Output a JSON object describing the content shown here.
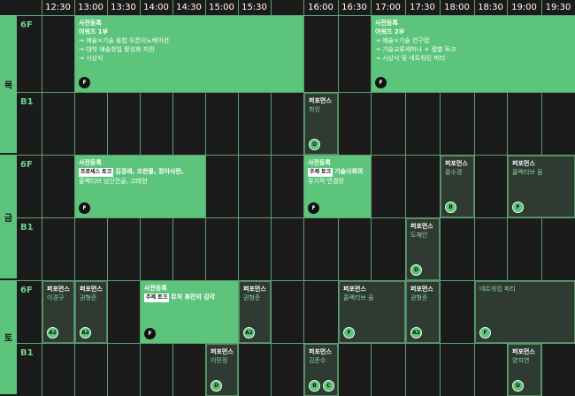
{
  "times": [
    "12:30",
    "13:00",
    "13:30",
    "14:00",
    "14:30",
    "15:00",
    "15:30",
    "",
    "16:00",
    "16:30",
    "17:00",
    "17:30",
    "18:00",
    "18:30",
    "19:00",
    "19:30"
  ],
  "days": [
    {
      "label": "목",
      "floors": [
        "6F",
        "B1"
      ]
    },
    {
      "label": "금",
      "floors": [
        "6F",
        "B1"
      ]
    },
    {
      "label": "토",
      "floors": [
        "6F",
        "B1"
      ]
    }
  ],
  "events": [
    {
      "row": 0,
      "s": 1,
      "e": 8,
      "kind": "green",
      "type": "사전등록",
      "title": "어워즈 1부",
      "lines": [
        "→ 예술×기술 융합 오픈이노베이션",
        "→ 대학 예술창업 활성화 지원",
        "→ 시상식"
      ],
      "badges": [
        "F"
      ]
    },
    {
      "row": 0,
      "s": 10,
      "e": 16,
      "kind": "green",
      "type": "사전등록",
      "title": "어워즈 2부",
      "lines": [
        "→ 예술×기술 연구랩",
        "→ 기술교류세미나 + 랩별 토크",
        "→ 시상식 및 네트워킹 파티"
      ],
      "badges": [
        "F"
      ]
    },
    {
      "row": 1,
      "s": 8,
      "e": 9,
      "kind": "dark",
      "type": "퍼포먼스",
      "title": "최인",
      "lines": [],
      "badges": [
        "D"
      ]
    },
    {
      "row": 2,
      "s": 1,
      "e": 5,
      "kind": "green",
      "type": "사전등록",
      "tag": "프로세스 토크",
      "title": "김경래, 조한울, 정아사란,",
      "lines": [
        "콜렉티브 남산전골, 고태현"
      ],
      "badges": [
        "F"
      ]
    },
    {
      "row": 2,
      "s": 8,
      "e": 10,
      "kind": "green",
      "type": "사전등록",
      "tag": "주제 토크",
      "title": "기술사회의",
      "lines": [
        "유기적 연결망"
      ],
      "badges": [
        "F"
      ]
    },
    {
      "row": 2,
      "s": 12,
      "e": 13,
      "kind": "dark",
      "type": "퍼포먼스",
      "title": "황수경",
      "lines": [],
      "badges": [
        "B"
      ]
    },
    {
      "row": 2,
      "s": 14,
      "e": 16,
      "kind": "dark",
      "type": "퍼포먼스",
      "title": "콜렉티브 꿈",
      "lines": [],
      "badges": [
        "F"
      ]
    },
    {
      "row": 3,
      "s": 11,
      "e": 12,
      "kind": "dark",
      "type": "퍼포먼스",
      "title": "도재인",
      "lines": [],
      "badges": [
        "D"
      ]
    },
    {
      "row": 4,
      "s": 0,
      "e": 1,
      "kind": "dark",
      "type": "퍼포먼스",
      "title": "이경구",
      "lines": [],
      "badges": [
        "A2"
      ]
    },
    {
      "row": 4,
      "s": 1,
      "e": 2,
      "kind": "dark",
      "type": "퍼포먼스",
      "title": "권형준",
      "lines": [],
      "badges": [
        "A2"
      ]
    },
    {
      "row": 4,
      "s": 3,
      "e": 6,
      "kind": "green",
      "type": "사전등록",
      "tag": "주제 토크",
      "title": "뮤처 휴먼의 감각",
      "lines": [],
      "badges": [
        "F"
      ]
    },
    {
      "row": 4,
      "s": 6,
      "e": 7,
      "kind": "dark",
      "type": "퍼포먼스",
      "title": "권형준",
      "lines": [],
      "badges": [
        "A2"
      ]
    },
    {
      "row": 4,
      "s": 9,
      "e": 11,
      "kind": "dark",
      "type": "퍼포먼스",
      "title": "콜렉티브 꿈",
      "lines": [],
      "badges": [
        "F"
      ]
    },
    {
      "row": 4,
      "s": 11,
      "e": 12,
      "kind": "dark",
      "type": "퍼포먼스",
      "title": "권형준",
      "lines": [],
      "badges": [
        "A2"
      ]
    },
    {
      "row": 4,
      "s": 13,
      "e": 16,
      "kind": "dark",
      "type": "",
      "title": "네트워킹 파티",
      "lines": [],
      "badges": [
        "F"
      ]
    },
    {
      "row": 5,
      "s": 5,
      "e": 6,
      "kind": "dark",
      "type": "퍼포먼스",
      "title": "이민정",
      "lines": [],
      "badges": [
        "D"
      ]
    },
    {
      "row": 5,
      "s": 8,
      "e": 9,
      "kind": "dark",
      "type": "퍼포먼스",
      "title": "김준수",
      "lines": [],
      "badges": [
        "B",
        "C"
      ]
    },
    {
      "row": 5,
      "s": 14,
      "e": 15,
      "kind": "dark",
      "type": "퍼포먼스",
      "title": "양지연",
      "lines": [],
      "badges": [
        "D"
      ]
    }
  ]
}
